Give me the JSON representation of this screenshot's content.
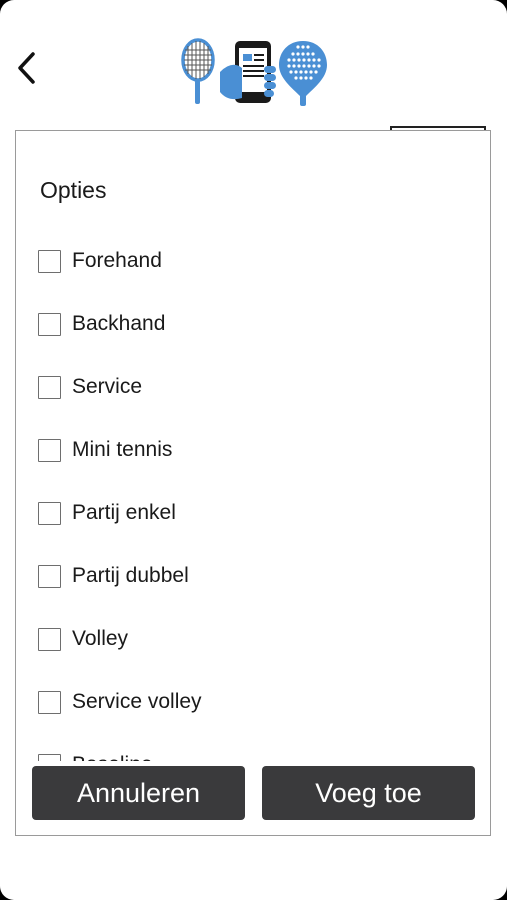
{
  "dialog": {
    "title": "Opties",
    "options": [
      {
        "label": "Forehand",
        "checked": false
      },
      {
        "label": "Backhand",
        "checked": false
      },
      {
        "label": "Service",
        "checked": false
      },
      {
        "label": "Mini tennis",
        "checked": false
      },
      {
        "label": "Partij enkel",
        "checked": false
      },
      {
        "label": "Partij dubbel",
        "checked": false
      },
      {
        "label": "Volley",
        "checked": false
      },
      {
        "label": "Service volley",
        "checked": false
      },
      {
        "label": "Baseline",
        "checked": false
      }
    ],
    "cancel_label": "Annuleren",
    "add_label": "Voeg toe"
  },
  "colors": {
    "accent_blue": "#4a8fd4",
    "button_bg": "#3a3a3c",
    "dialog_border": "#9a9a9a"
  },
  "icons": {
    "back": "chevron-left-icon",
    "logo": "tennis-padel-app-logo"
  }
}
